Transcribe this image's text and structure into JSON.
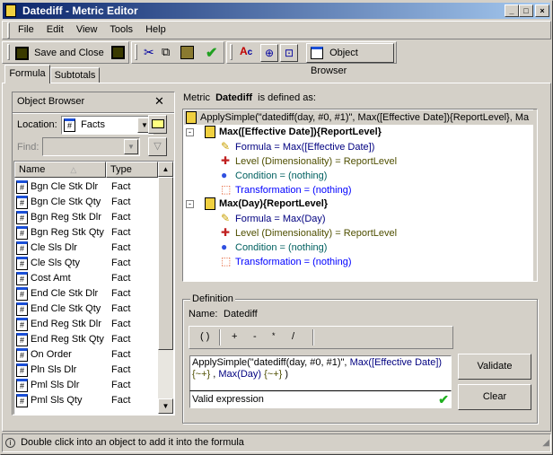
{
  "window": {
    "title": "Datediff - Metric Editor"
  },
  "menu": [
    "File",
    "Edit",
    "View",
    "Tools",
    "Help"
  ],
  "toolbar": {
    "save_close": "Save and Close",
    "object_browser": "Object Browser"
  },
  "tabs": [
    "Formula",
    "Subtotals"
  ],
  "object_browser": {
    "title": "Object Browser",
    "location_label": "Location:",
    "location_value": "Facts",
    "find_label": "Find:",
    "columns": [
      "Name",
      "Type"
    ],
    "items": [
      {
        "name": "Bgn Cle Stk Dlr",
        "type": "Fact"
      },
      {
        "name": "Bgn Cle Stk Qty",
        "type": "Fact"
      },
      {
        "name": "Bgn Reg Stk Dlr",
        "type": "Fact"
      },
      {
        "name": "Bgn Reg Stk Qty",
        "type": "Fact"
      },
      {
        "name": "Cle Sls Dlr",
        "type": "Fact"
      },
      {
        "name": "Cle Sls Qty",
        "type": "Fact"
      },
      {
        "name": "Cost Amt",
        "type": "Fact"
      },
      {
        "name": "End Cle Stk Dlr",
        "type": "Fact"
      },
      {
        "name": "End Cle Stk Qty",
        "type": "Fact"
      },
      {
        "name": "End Reg Stk Dlr",
        "type": "Fact"
      },
      {
        "name": "End Reg Stk Qty",
        "type": "Fact"
      },
      {
        "name": "On Order",
        "type": "Fact"
      },
      {
        "name": "Pln Sls Dlr",
        "type": "Fact"
      },
      {
        "name": "Pml Sls Dlr",
        "type": "Fact"
      },
      {
        "name": "Pml Sls Qty",
        "type": "Fact"
      }
    ]
  },
  "metric": {
    "prefix": "Metric",
    "name": "Datediff",
    "suffix": "is defined as:",
    "root": "ApplySimple(\"datediff(day, #0, #1)\", Max([Effective Date]){ReportLevel}, Ma",
    "nodes": [
      {
        "label": "Max([Effective Date]){ReportLevel}",
        "formula": "Formula = Max([Effective Date])",
        "level": "Level (Dimensionality) = ReportLevel",
        "condition": "Condition = (nothing)",
        "transformation": "Transformation = (nothing)"
      },
      {
        "label": "Max(Day){ReportLevel}",
        "formula": "Formula = Max(Day)",
        "level": "Level (Dimensionality) = ReportLevel",
        "condition": "Condition = (nothing)",
        "transformation": "Transformation = (nothing)"
      }
    ]
  },
  "definition": {
    "group_label": "Definition",
    "name_label": "Name:",
    "name_value": "Datediff",
    "operators": [
      "( )",
      "+",
      "-",
      "*",
      "/"
    ],
    "formula_part1": "ApplySimple(\"datediff(day, #0, #1)\", ",
    "formula_part2": "Max([Effective Date])",
    "formula_part3": "{~+}",
    "formula_part4": " , ",
    "formula_part5": "Max(Day)",
    "formula_part6": " {~+}",
    "formula_part7": " )",
    "status": "Valid expression",
    "validate": "Validate",
    "clear": "Clear"
  },
  "statusbar": "Double click into an object to add it into the formula",
  "colors": {
    "title_start": "#0a246a",
    "title_end": "#a6caf0",
    "formula_blue": "#000080",
    "level_olive": "#4f4f00",
    "condition_teal": "#006060",
    "transformation_blue": "#0000ff"
  }
}
